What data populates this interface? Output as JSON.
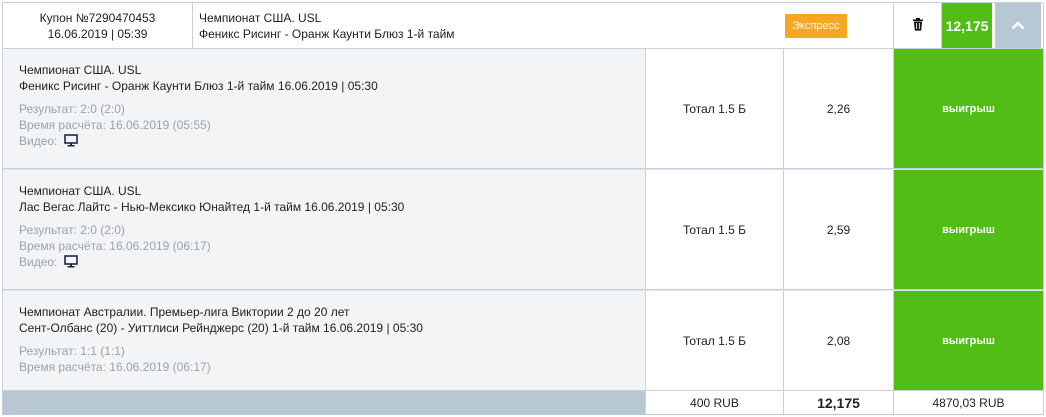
{
  "header": {
    "coupon_number": "Купон №7290470453",
    "coupon_date": "16.06.2019 | 05:39",
    "championship": "Чемпионат США. USL",
    "match": "Феникс Рисинг - Оранж Каунти Блюз 1-й тайм",
    "type_badge": "Экспресс",
    "total_odds": "12,175"
  },
  "rows": [
    {
      "championship": "Чемпионат США. USL",
      "event": "Феникс Рисинг - Оранж Каунти Блюз 1-й тайм 16.06.2019 | 05:30",
      "result": "Результат: 2:0 (2:0)",
      "settled": "Время расчёта: 16.06.2019 (05:55)",
      "video_label": "Видео:",
      "bet": "Тотал 1.5 Б",
      "odds": "2,26",
      "status": "выигрыш"
    },
    {
      "championship": "Чемпионат США. USL",
      "event": "Лас Вегас Лайтс - Нью-Мексико Юнайтед 1-й тайм 16.06.2019 | 05:30",
      "result": "Результат: 2:0 (2:0)",
      "settled": "Время расчёта: 16.06.2019 (06:17)",
      "video_label": "Видео:",
      "bet": "Тотал 1.5 Б",
      "odds": "2,59",
      "status": "выигрыш"
    },
    {
      "championship": "Чемпионат Австралии. Премьер-лига Виктории 2 до 20 лет",
      "event": "Сент-Олбанс (20) - Уиттлиси Рейнджерс (20) 1-й тайм 16.06.2019 | 05:30",
      "result": "Результат: 1:1 (1:1)",
      "settled": "Время расчёта: 16.06.2019 (06:17)",
      "bet": "Тотал 1.5 Б",
      "odds": "2,08",
      "status": "выигрыш"
    }
  ],
  "footer": {
    "stake": "400 RUB",
    "total_odds": "12,175",
    "payout": "4870,03 RUB"
  }
}
